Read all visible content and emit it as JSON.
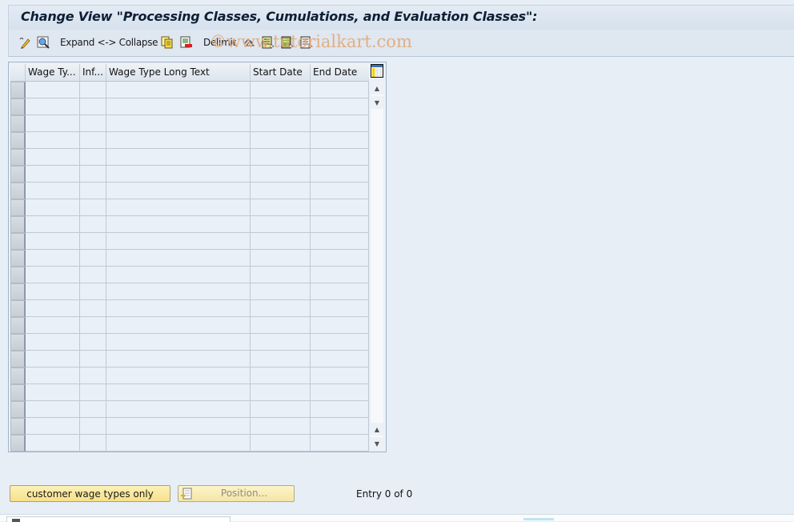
{
  "title": "Change View \"Processing Classes, Cumulations, and Evaluation Classes\":",
  "toolbar": {
    "items": [
      {
        "icon": "display-change-icon"
      },
      {
        "icon": "details-icon"
      },
      {
        "label": "Expand <-> Collapse"
      },
      {
        "icon": "copy-as-icon"
      },
      {
        "icon": "delete-icon"
      },
      {
        "label": "Delimit"
      },
      {
        "icon": "undo-change-icon"
      },
      {
        "icon": "select-all-icon"
      },
      {
        "icon": "select-block-icon"
      },
      {
        "icon": "deselect-all-icon"
      }
    ],
    "expand_collapse_label": "Expand <-> Collapse",
    "delimit_label": "Delimit"
  },
  "watermark": "©www.tutorialkart.com",
  "table": {
    "columns": [
      "Wage Ty...",
      "Inf...",
      "Wage Type Long Text",
      "Start Date",
      "End Date"
    ],
    "row_count_visible": 22,
    "rows": []
  },
  "buttons": {
    "customer_wage_types": "customer wage types only",
    "position": "Position..."
  },
  "entry_info": "Entry 0 of 0"
}
